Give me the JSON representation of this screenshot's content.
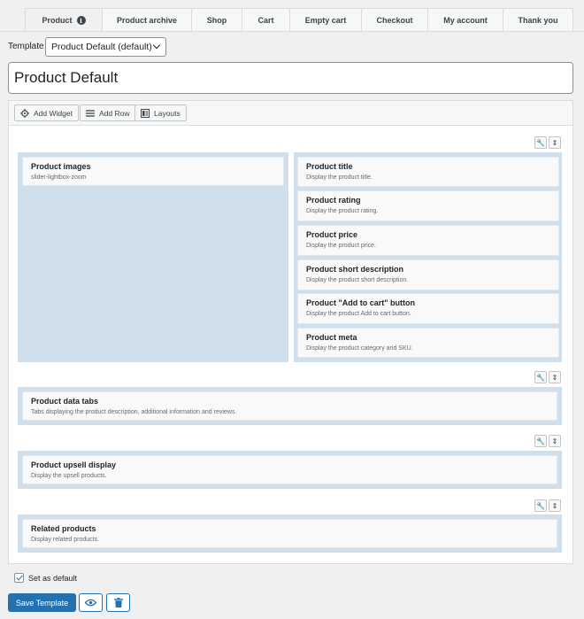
{
  "tabs": [
    {
      "label": "Product",
      "active": true,
      "icon": "info-icon"
    },
    {
      "label": "Product archive"
    },
    {
      "label": "Shop"
    },
    {
      "label": "Cart"
    },
    {
      "label": "Empty cart"
    },
    {
      "label": "Checkout"
    },
    {
      "label": "My account"
    },
    {
      "label": "Thank you"
    }
  ],
  "template": {
    "label": "Template",
    "selected": "Product Default (default)"
  },
  "title_value": "Product Default",
  "toolbar": {
    "add_widget": "Add Widget",
    "add_row": "Add Row",
    "layouts": "Layouts"
  },
  "rows": {
    "row1": {
      "left": [
        {
          "title": "Product images",
          "desc": "slider-lightbox-zoom"
        }
      ],
      "right": [
        {
          "title": "Product title",
          "desc": "Display the product title."
        },
        {
          "title": "Product rating",
          "desc": "Display the product rating."
        },
        {
          "title": "Product price",
          "desc": "Display the product price."
        },
        {
          "title": "Product short description",
          "desc": "Display the product short description."
        },
        {
          "title": "Product \"Add to cart\" button",
          "desc": "Display the product Add to cart button."
        },
        {
          "title": "Product meta",
          "desc": "Display the product category and SKU."
        }
      ]
    },
    "row2": {
      "title": "Product data tabs",
      "desc": "Tabs displaying the product description, additional information and reviews."
    },
    "row3": {
      "title": "Product upsell display",
      "desc": "Display the upsell products."
    },
    "row4": {
      "title": "Related products",
      "desc": "Display related products."
    }
  },
  "set_default": {
    "label": "Set as default",
    "checked": true
  },
  "buttons": {
    "save": "Save Template"
  },
  "colors": {
    "accent": "#2271b1",
    "cell_bg": "#cfe0ec"
  }
}
